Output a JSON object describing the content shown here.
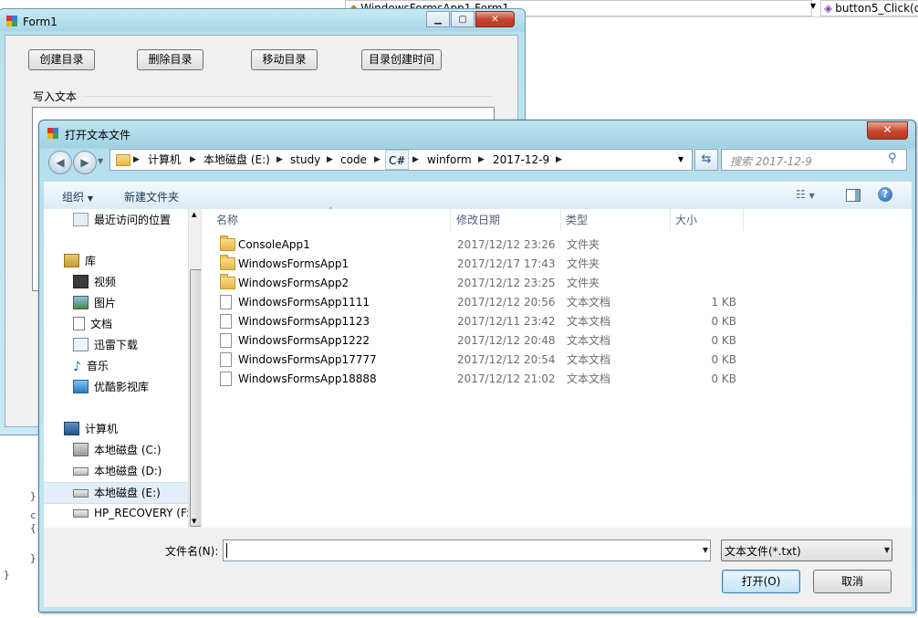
{
  "ide": {
    "combo1": "WindowsFormsApp1.Form1",
    "combo2": "button5_Click(o"
  },
  "form1": {
    "title": "Form1",
    "buttons": [
      "创建目录",
      "删除目录",
      "移动目录",
      "目录创建时间"
    ],
    "group_label": "写入文本"
  },
  "dialog": {
    "title": "打开文本文件",
    "close": "✕",
    "breadcrumbs": [
      "计算机",
      "本地磁盘 (E:)",
      "study",
      "code",
      "C#",
      "winform",
      "2017-12-9"
    ],
    "search_placeholder": "搜索 2017-12-9",
    "toolbar": {
      "organize": "组织",
      "new_folder": "新建文件夹"
    },
    "nav": {
      "items": [
        {
          "label": "最近访问的位置",
          "icon": "recent-places-icon"
        },
        {
          "label": "库",
          "icon": "library-icon"
        },
        {
          "label": "视频",
          "icon": "video-icon"
        },
        {
          "label": "图片",
          "icon": "picture-icon"
        },
        {
          "label": "文档",
          "icon": "document-icon"
        },
        {
          "label": "迅雷下载",
          "icon": "download-icon"
        },
        {
          "label": "音乐",
          "icon": "music-icon"
        },
        {
          "label": "优酷影视库",
          "icon": "video-library-icon"
        },
        {
          "label": "计算机",
          "icon": "computer-icon"
        },
        {
          "label": "本地磁盘 (C:)",
          "icon": "drive-c-icon"
        },
        {
          "label": "本地磁盘 (D:)",
          "icon": "drive-icon"
        },
        {
          "label": "本地磁盘 (E:)",
          "icon": "drive-icon"
        },
        {
          "label": "HP_RECOVERY (F:",
          "icon": "drive-icon"
        }
      ]
    },
    "columns": [
      "名称",
      "修改日期",
      "类型",
      "大小"
    ],
    "files": [
      {
        "name": "ConsoleApp1",
        "date": "2017/12/12 23:26",
        "type": "文件夹",
        "size": "",
        "kind": "folder"
      },
      {
        "name": "WindowsFormsApp1",
        "date": "2017/12/17 17:43",
        "type": "文件夹",
        "size": "",
        "kind": "folder"
      },
      {
        "name": "WindowsFormsApp2",
        "date": "2017/12/12 23:25",
        "type": "文件夹",
        "size": "",
        "kind": "folder"
      },
      {
        "name": "WindowsFormsApp1111",
        "date": "2017/12/12 20:56",
        "type": "文本文档",
        "size": "1 KB",
        "kind": "file"
      },
      {
        "name": "WindowsFormsApp1123",
        "date": "2017/12/11 23:42",
        "type": "文本文档",
        "size": "0 KB",
        "kind": "file"
      },
      {
        "name": "WindowsFormsApp1222",
        "date": "2017/12/12 20:48",
        "type": "文本文档",
        "size": "0 KB",
        "kind": "file"
      },
      {
        "name": "WindowsFormsApp17777",
        "date": "2017/12/12 20:54",
        "type": "文本文档",
        "size": "0 KB",
        "kind": "file"
      },
      {
        "name": "WindowsFormsApp18888",
        "date": "2017/12/12 21:02",
        "type": "文本文档",
        "size": "0 KB",
        "kind": "file"
      }
    ],
    "filename_label": "文件名(N):",
    "filename_value": "",
    "filetype": "文本文件(*.txt)",
    "open": "打开(O)",
    "cancel": "取消"
  }
}
